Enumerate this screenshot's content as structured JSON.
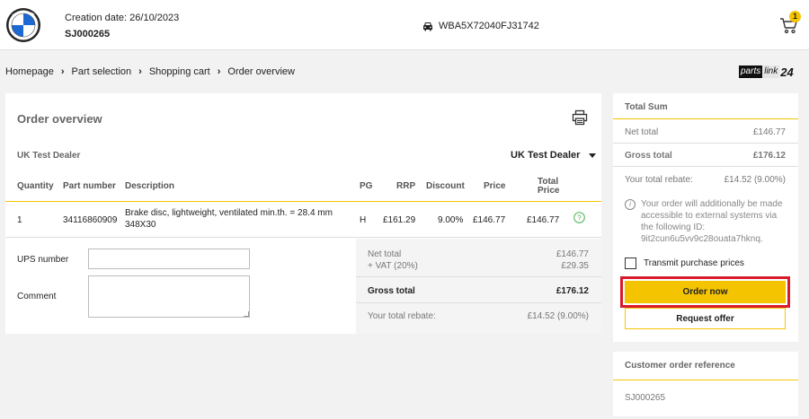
{
  "header": {
    "creation_date": "Creation date: 26/10/2023",
    "job_id": "SJ000265",
    "vin": "WBA5X72040FJ31742",
    "cart_count": "1"
  },
  "breadcrumb": [
    "Homepage",
    "Part selection",
    "Shopping cart",
    "Order overview"
  ],
  "brand": {
    "part_a": "parts",
    "part_b": "link",
    "part_c": "24"
  },
  "overview": {
    "title": "Order overview",
    "dealer_label": "UK Test Dealer",
    "dealer_selected": "UK Test Dealer",
    "columns": {
      "quantity": "Quantity",
      "part_number": "Part number",
      "description": "Description",
      "pg": "PG",
      "rrp": "RRP",
      "discount": "Discount",
      "price": "Price",
      "total_price_1": "Total",
      "total_price_2": "Price"
    },
    "row": {
      "quantity": "1",
      "part_number": "34116860909",
      "description_1": "Brake disc, lightweight, ventilated min.th. = 28.4 mm",
      "description_2": "348X30",
      "pg": "H",
      "rrp": "£161.29",
      "discount": "9.00%",
      "price": "£146.77",
      "total": "£146.77"
    },
    "ups_label": "UPS number",
    "ups_value": "",
    "comment_label": "Comment",
    "comment_value": "",
    "summary": {
      "net_label": "Net total",
      "net_value": "£146.77",
      "vat_label": "+ VAT (20%)",
      "vat_value": "£29.35",
      "gross_label": "Gross total",
      "gross_value": "£176.12",
      "rebate_label": "Your total rebate:",
      "rebate_value": "£14.52 (9.00%)"
    }
  },
  "total_panel": {
    "title": "Total Sum",
    "net_label": "Net total",
    "net_value": "£146.77",
    "gross_label": "Gross total",
    "gross_value": "£176.12",
    "rebate_label": "Your total rebate:",
    "rebate_value": "£14.52 (9.00%)",
    "info_text": "Your order will additionally be made accessible to external systems via the following ID: 9it2cun6u5vv9c28ouata7hknq.",
    "transmit_label": "Transmit purchase prices",
    "transmit_checked": false,
    "order_button": "Order now",
    "offer_button": "Request offer"
  },
  "reference_panel": {
    "title": "Customer order reference",
    "value": "SJ000265"
  },
  "colors": {
    "accent": "#f5c400",
    "highlight": "#d81b2a",
    "ok": "#4caf50"
  }
}
